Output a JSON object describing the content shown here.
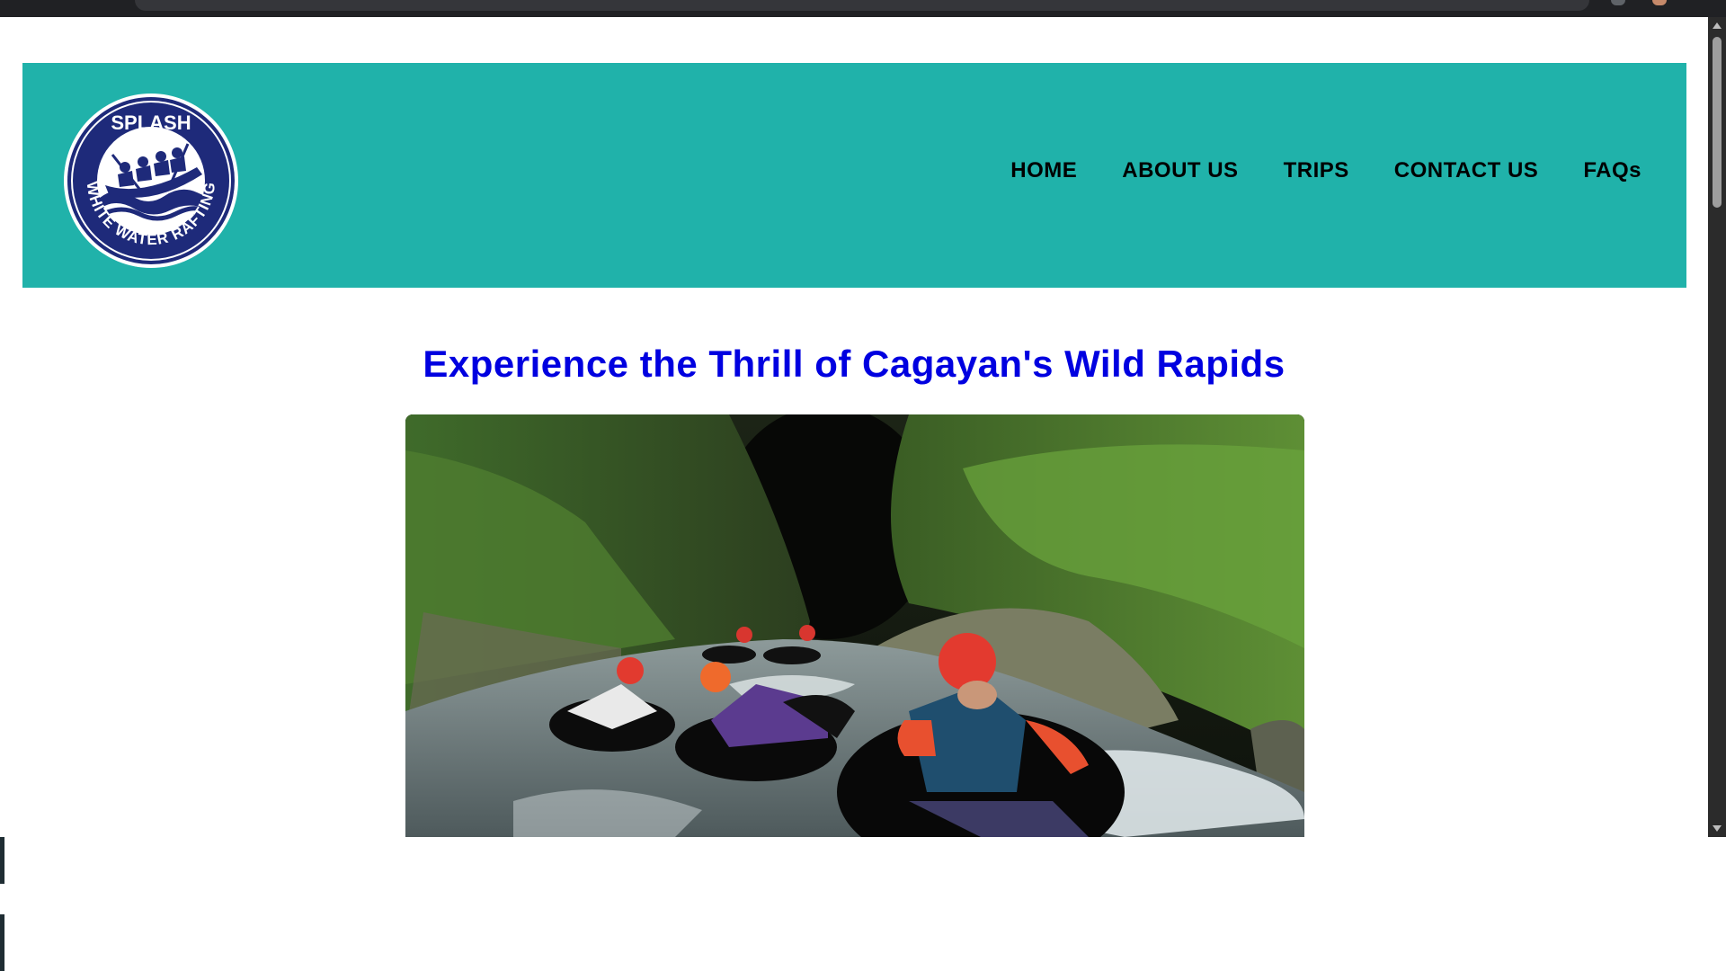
{
  "header": {
    "logo": {
      "top_text": "SPLASH",
      "ring_text": "WHITE WATER RAFTING",
      "colors": {
        "ring": "#1e2a7a",
        "inner": "#ffffff",
        "border": "#ffffff"
      }
    },
    "nav": [
      {
        "label": "HOME"
      },
      {
        "label": "ABOUT US"
      },
      {
        "label": "TRIPS"
      },
      {
        "label": "CONTACT US"
      },
      {
        "label": "FAQs"
      }
    ],
    "background_color": "#20b2aa"
  },
  "hero": {
    "title": "Experience the Thrill of Cagayan's Wild Rapids",
    "title_color": "#0000e0",
    "image_subject": "people river tubing in red helmets through a green canyon"
  }
}
